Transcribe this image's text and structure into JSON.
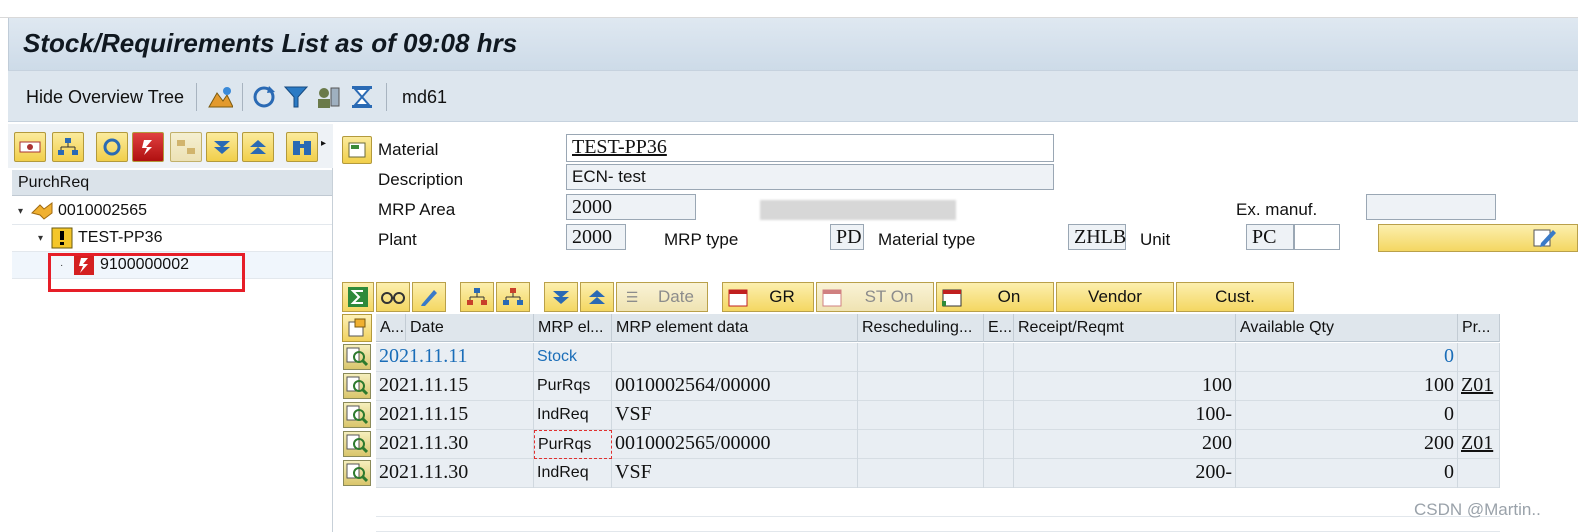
{
  "window": {
    "title": "Stock/Requirements List as of 09:08 hrs"
  },
  "appbar": {
    "hide_tree_label": "Hide Overview Tree",
    "transaction": "md61"
  },
  "tree": {
    "header": "PurchReq",
    "nodes": [
      {
        "label": "0010002565",
        "level": 0
      },
      {
        "label": "TEST-PP36",
        "level": 1
      },
      {
        "label": "9100000002",
        "level": 2
      }
    ]
  },
  "header": {
    "material_label": "Material",
    "material_value": "TEST-PP36",
    "description_label": "Description",
    "description_value": "ECN- test",
    "mrp_area_label": "MRP Area",
    "mrp_area_value": "2000",
    "ex_manuf_label": "Ex. manuf.",
    "plant_label": "Plant",
    "plant_value": "2000",
    "mrp_type_label": "MRP type",
    "mrp_type_value": "PD",
    "material_type_label": "Material type",
    "material_type_value": "ZHLB",
    "unit_label": "Unit",
    "unit_value": "PC"
  },
  "grid_toolbar": {
    "date": "Date",
    "gr": "GR",
    "st_on": "ST On",
    "on": "On",
    "vendor": "Vendor",
    "cust": "Cust."
  },
  "columns": [
    "A...",
    "Date",
    "MRP el...",
    "MRP element data",
    "Rescheduling...",
    "E...",
    "Receipt/Reqmt",
    "Available Qty",
    "Pr..."
  ],
  "rows": [
    {
      "date": "2021.11.11",
      "mrp_el": "Stock",
      "data": "",
      "receipt": "",
      "available": "0",
      "pr": ""
    },
    {
      "date": "2021.11.15",
      "mrp_el": "PurRqs",
      "data": "0010002564/00000",
      "receipt": "100",
      "available": "100",
      "pr": "Z01"
    },
    {
      "date": "2021.11.15",
      "mrp_el": "IndReq",
      "data": "VSF",
      "receipt": "100-",
      "available": "0",
      "pr": ""
    },
    {
      "date": "2021.11.30",
      "mrp_el": "PurRqs",
      "data": "0010002565/00000",
      "receipt": "200",
      "available": "200",
      "pr": "Z01"
    },
    {
      "date": "2021.11.30",
      "mrp_el": "IndReq",
      "data": "VSF",
      "receipt": "200-",
      "available": "0",
      "pr": ""
    }
  ],
  "watermark": "CSDN @Martin..",
  "colors": {
    "accent_yellow": "#f4d762",
    "title_bg": "#cddbe8",
    "stock_blue": "#1a6db8",
    "highlight_red": "#e61e28"
  }
}
